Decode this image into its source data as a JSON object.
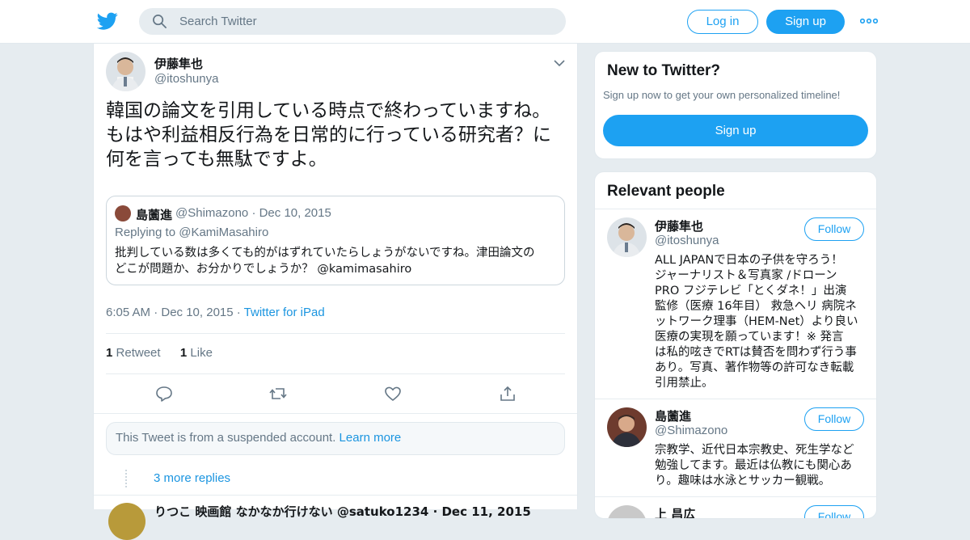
{
  "header": {
    "search_placeholder": "Search Twitter",
    "login_label": "Log in",
    "signup_label": "Sign up",
    "brand_color": "#1da1f2"
  },
  "tweet": {
    "author_name": "伊藤隼也",
    "author_handle": "@itoshunya",
    "text_lines": [
      "韓国の論文を引用している時点で終わっていますね。",
      "もはや利益相反行為を日常的に行っている研究者？に",
      "何を言っても無駄ですよ。"
    ],
    "quote": {
      "name": "島薗進",
      "meta": "@Shimazono · Dec 10, 2015",
      "replying_to": "Replying to @KamiMasahiro",
      "text_line1": "批判している数は多くても的がはずれていたらしょうがないですね。津田論文の",
      "text_line2": "どこが問題か、お分かりでしょうか？",
      "mention": "@kamimasahiro"
    },
    "time": "6:05 AM · Dec 10, 2015 · ",
    "source": "Twitter for iPad",
    "retweet_count": "1",
    "retweet_label": "Retweet",
    "like_count": "1",
    "like_label": "Like"
  },
  "suspended": {
    "text": "This Tweet is from a suspended account. ",
    "link": "Learn more"
  },
  "more_replies": "3 more replies",
  "next_reply_preview": "りつこ 映画館 なかなか行けない @satuko1234 · Dec 11, 2015",
  "sidebar": {
    "new_title": "New to Twitter?",
    "new_sub": "Sign up now to get your own personalized timeline!",
    "new_button": "Sign up",
    "relevant_title": "Relevant people",
    "people": [
      {
        "name": "伊藤隼也",
        "handle": "@itoshunya",
        "follow": "Follow",
        "bio_lines": [
          "ALL JAPANで日本の子供を守ろう！",
          "ジャーナリスト＆写真家 /ドローン",
          "PRO フジテレビ「とくダネ！」出演",
          "監修（医療 16年目） 救急ヘリ 病院ネ",
          "ットワーク理事（HEM-Net）より良い",
          "医療の実現を願っています！※ 発言",
          "は私的呟きでRTは賛否を問わず行う事",
          "あり。写真、著作物等の許可なき転載",
          "引用禁止。"
        ]
      },
      {
        "name": "島薗進",
        "handle": "@Shimazono",
        "follow": "Follow",
        "bio_lines": [
          "宗教学、近代日本宗教史、死生学など",
          "勉強してます。最近は仏教にも関心あ",
          "り。趣味は水泳とサッカー観戦。"
        ]
      },
      {
        "name": "上 昌広",
        "handle": "",
        "follow": "Follow",
        "bio_lines": []
      }
    ]
  }
}
